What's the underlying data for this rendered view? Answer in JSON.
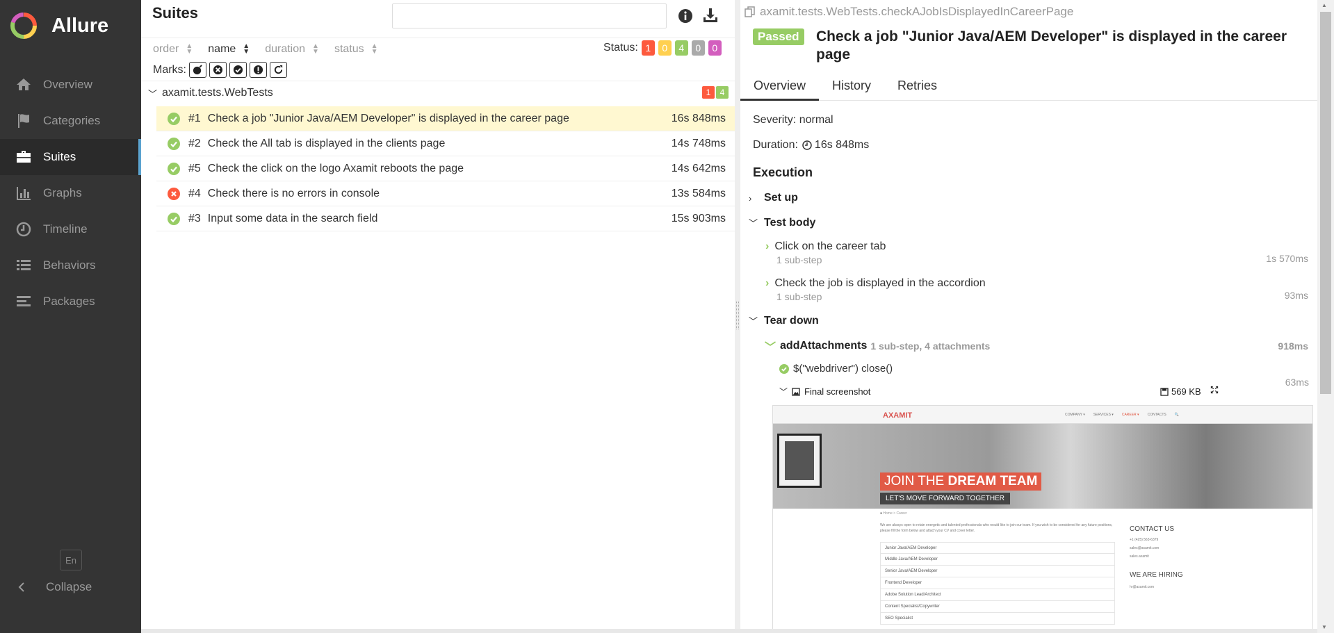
{
  "app": {
    "name": "Allure"
  },
  "sidebar": {
    "items": [
      {
        "label": "Overview",
        "icon": "home-icon"
      },
      {
        "label": "Categories",
        "icon": "flag-icon"
      },
      {
        "label": "Suites",
        "icon": "briefcase-icon",
        "active": true
      },
      {
        "label": "Graphs",
        "icon": "bar-chart-icon"
      },
      {
        "label": "Timeline",
        "icon": "clock-icon"
      },
      {
        "label": "Behaviors",
        "icon": "list-icon"
      },
      {
        "label": "Packages",
        "icon": "align-left-icon"
      }
    ],
    "lang": "En",
    "collapse": "Collapse"
  },
  "suites": {
    "title": "Suites",
    "search_value": "",
    "sort": {
      "order": "order",
      "name": "name",
      "duration": "duration",
      "status": "status"
    },
    "status_label": "Status:",
    "status_counts": [
      {
        "value": "1",
        "color": "#fd5a3e"
      },
      {
        "value": "0",
        "color": "#ffd050"
      },
      {
        "value": "4",
        "color": "#97cc64"
      },
      {
        "value": "0",
        "color": "#aaaaaa"
      },
      {
        "value": "0",
        "color": "#d35ebe"
      }
    ],
    "marks_label": "Marks:",
    "group": {
      "name": "axamit.tests.WebTests",
      "failed": "1",
      "passed": "4"
    },
    "tests": [
      {
        "num": "#1",
        "name": "Check a job \"Junior Java/AEM Developer\" is displayed in the career page",
        "duration": "16s 848ms",
        "status": "passed",
        "selected": true
      },
      {
        "num": "#2",
        "name": "Check the All tab is displayed in the clients page",
        "duration": "14s 748ms",
        "status": "passed"
      },
      {
        "num": "#5",
        "name": "Check the click on the logo Axamit reboots the page",
        "duration": "14s 642ms",
        "status": "passed"
      },
      {
        "num": "#4",
        "name": "Check there is no errors in console",
        "duration": "13s 584ms",
        "status": "failed"
      },
      {
        "num": "#3",
        "name": "Input some data in the search field",
        "duration": "15s 903ms",
        "status": "passed"
      }
    ]
  },
  "details": {
    "breadcrumb": "axamit.tests.WebTests.checkAJobIsDisplayedInCareerPage",
    "status_badge": "Passed",
    "title": "Check a job \"Junior Java/AEM Developer\" is displayed in the career page",
    "tabs": [
      "Overview",
      "History",
      "Retries"
    ],
    "severity": "Severity: normal",
    "duration_label": "Duration:",
    "duration_value": "16s 848ms",
    "execution_title": "Execution",
    "setup": "Set up",
    "test_body": "Test body",
    "steps": [
      {
        "name": "Click on the career tab",
        "sub": "1 sub-step",
        "duration": "1s 570ms"
      },
      {
        "name": "Check the job is displayed in the accordion",
        "sub": "1 sub-step",
        "duration": "93ms"
      }
    ],
    "tear_down": "Tear down",
    "add_attachments": {
      "name": "addAttachments",
      "sub": "1 sub-step, 4 attachments",
      "duration": "918ms"
    },
    "close_step": {
      "name": "$(\"webdriver\") close()",
      "duration": "63ms"
    },
    "attachment": {
      "name": "Final screenshot",
      "size": "569 KB"
    }
  },
  "screenshot": {
    "logo": "AXAMIT",
    "nav": [
      "COMPANY ▾",
      "SERVICES ▾",
      "CAREER ▾",
      "CONTACTS",
      "🔍"
    ],
    "join_plain": "JOIN THE ",
    "join_bold": "DREAM TEAM",
    "join_sub": "LET'S MOVE FORWARD TOGETHER",
    "crumb": "■ Home  >  Career",
    "intro": "We are always open to retain energetic and talented professionals who would like to join our team. If you wish to be considered for any future positions, please fill the form below and attach your CV and cover letter.",
    "jobs": [
      "Junior Java/AEM Developer",
      "Middle Java/AEM Developer",
      "Senior Java/AEM Developer",
      "Frontend Developer",
      "Adobe Solution Lead/Architect",
      "Content Specialist/Copywriter",
      "SEO Specialist"
    ],
    "contact_title": "CONTACT US",
    "contact_lines": [
      "+1 (425) 563-6379",
      "sales@axamit.com",
      "sales.axamit"
    ],
    "hiring_title": "WE ARE HIRING",
    "hiring_mail": "hr@axamit.com"
  }
}
